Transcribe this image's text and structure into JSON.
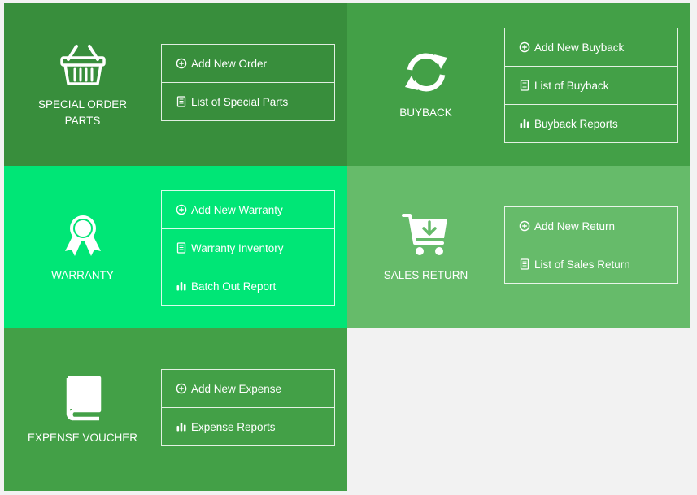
{
  "tiles": [
    {
      "title": "SPECIAL ORDER PARTS",
      "icon": "basket-icon",
      "menu": [
        {
          "label": "Add New Order",
          "icon": "plus-circle-icon"
        },
        {
          "label": "List of Special Parts",
          "icon": "list-doc-icon"
        }
      ]
    },
    {
      "title": "BUYBACK",
      "icon": "refresh-icon",
      "menu": [
        {
          "label": "Add New Buyback",
          "icon": "plus-circle-icon"
        },
        {
          "label": "List of Buyback",
          "icon": "list-doc-icon"
        },
        {
          "label": "Buyback Reports",
          "icon": "bar-chart-icon"
        }
      ]
    },
    {
      "title": "WARRANTY",
      "icon": "award-ribbon-icon",
      "menu": [
        {
          "label": "Add New Warranty",
          "icon": "plus-circle-icon"
        },
        {
          "label": "Warranty Inventory",
          "icon": "list-doc-icon"
        },
        {
          "label": "Batch Out Report",
          "icon": "bar-chart-icon"
        }
      ]
    },
    {
      "title": "SALES RETURN",
      "icon": "cart-download-icon",
      "menu": [
        {
          "label": "Add New Return",
          "icon": "plus-circle-icon"
        },
        {
          "label": "List of Sales Return",
          "icon": "list-doc-icon"
        }
      ]
    },
    {
      "title": "EXPENSE VOUCHER",
      "icon": "book-icon",
      "menu": [
        {
          "label": "Add New Expense",
          "icon": "plus-circle-icon"
        },
        {
          "label": "Expense Reports",
          "icon": "bar-chart-icon"
        }
      ]
    }
  ],
  "colors": {
    "special_order": "#388e3c",
    "buyback": "#43a047",
    "warranty": "#00e676",
    "sales_return": "#66bb6a",
    "expense": "#43a047",
    "page_bg": "#f2f2f2"
  }
}
